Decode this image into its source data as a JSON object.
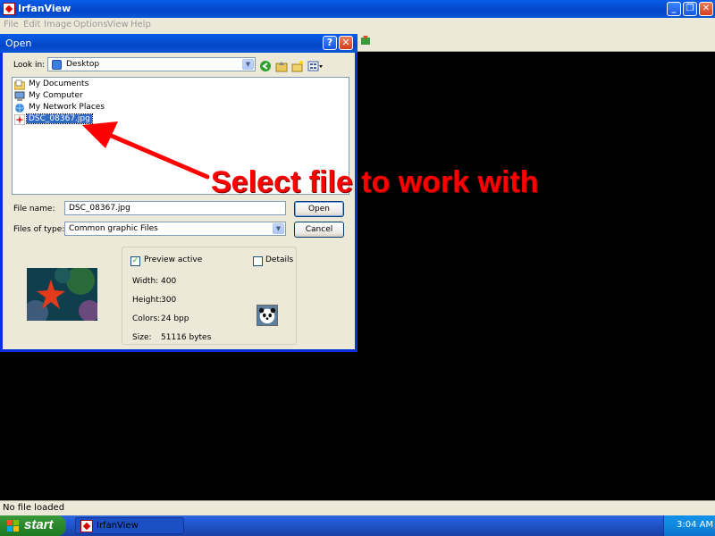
{
  "app": {
    "title": "IrfanView",
    "menu": [
      "File",
      "Edit",
      "Image",
      "Options",
      "View",
      "Help"
    ],
    "status": "No file loaded"
  },
  "dialog": {
    "title": "Open",
    "look_in_label": "Look in:",
    "look_in_value": "Desktop",
    "items": [
      {
        "name": "My Documents",
        "icon": "folder-documents-icon"
      },
      {
        "name": "My Computer",
        "icon": "computer-icon"
      },
      {
        "name": "My Network Places",
        "icon": "network-places-icon"
      },
      {
        "name": "DSC_08367.jpg",
        "icon": "image-file-icon",
        "selected": true
      }
    ],
    "file_name_label": "File name:",
    "file_name_value": "DSC_08367.jpg",
    "files_of_type_label": "Files of type:",
    "files_of_type_value": "Common graphic Files",
    "open_label": "Open",
    "cancel_label": "Cancel",
    "preview_active_label": "Preview active",
    "preview_active_checked": true,
    "details_label": "Details",
    "details_checked": false,
    "width_label": "Width:",
    "width_value": "400",
    "height_label": "Height:",
    "height_value": "300",
    "colors_label": "Colors:",
    "colors_value": "24 bpp",
    "size_label": "Size:",
    "size_value": "51116 bytes"
  },
  "annotation": {
    "text": "Select file to work with",
    "color": "#ff0000"
  },
  "taskbar": {
    "start_label": "start",
    "task_label": "IrfanView",
    "clock": "3:04 AM"
  },
  "colors": {
    "title_blue": "#0a5de8",
    "selection": "#316ac5",
    "dialog_bg": "#ece9d8",
    "taskbar": "#245edb",
    "start_green": "#2d8a2d"
  }
}
